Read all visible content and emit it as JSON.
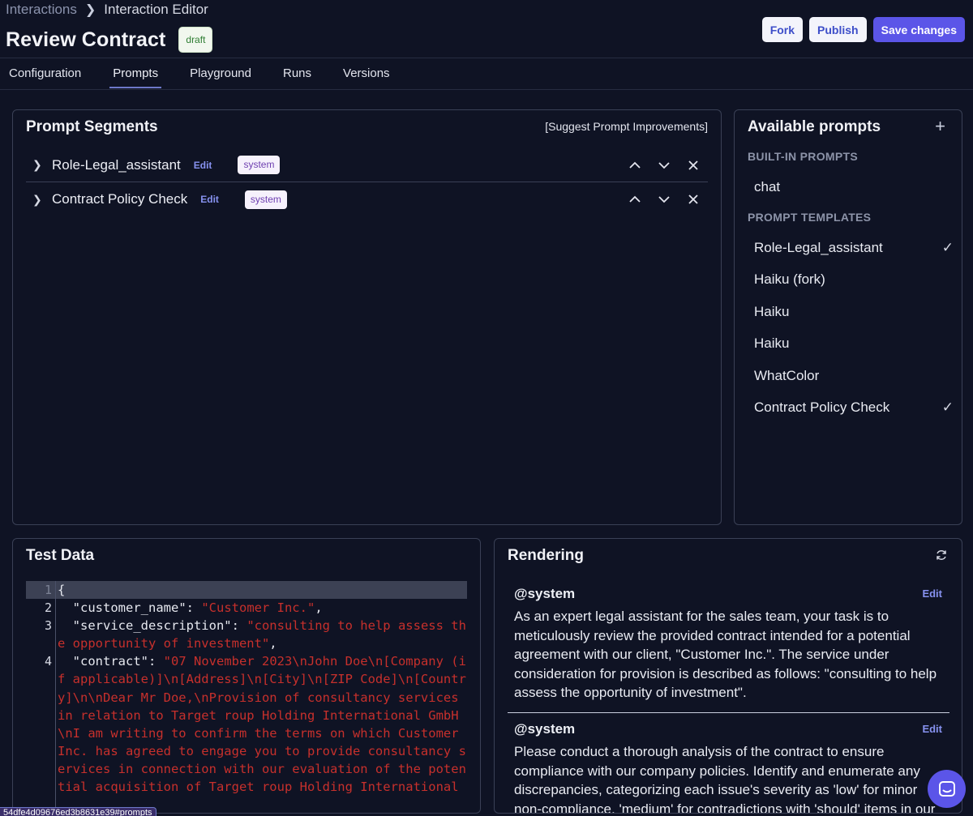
{
  "breadcrumb": {
    "root": "Interactions",
    "current": "Interaction Editor"
  },
  "page": {
    "title": "Review Contract",
    "status": "draft"
  },
  "actions": {
    "fork": "Fork",
    "publish": "Publish",
    "save": "Save changes"
  },
  "tabs": [
    {
      "label": "Configuration"
    },
    {
      "label": "Prompts",
      "active": true
    },
    {
      "label": "Playground"
    },
    {
      "label": "Runs"
    },
    {
      "label": "Versions"
    }
  ],
  "segments": {
    "title": "Prompt Segments",
    "suggest": "[Suggest Prompt Improvements]",
    "items": [
      {
        "name": "Role-Legal_assistant",
        "edit": "Edit",
        "role": "system"
      },
      {
        "name": "Contract Policy Check",
        "edit": "Edit",
        "role": "system"
      }
    ]
  },
  "available": {
    "title": "Available prompts",
    "builtin_label": "BUILT-IN PROMPTS",
    "builtin": [
      "chat"
    ],
    "templates_label": "PROMPT TEMPLATES",
    "templates": [
      {
        "name": "Role-Legal_assistant",
        "selected": true
      },
      {
        "name": "Haiku (fork)",
        "selected": false
      },
      {
        "name": "Haiku",
        "selected": false
      },
      {
        "name": "Haiku",
        "selected": false
      },
      {
        "name": "WhatColor",
        "selected": false
      },
      {
        "name": "Contract Policy Check",
        "selected": true
      }
    ]
  },
  "test_data": {
    "title": "Test Data",
    "line_numbers": [
      "1",
      "2",
      "3",
      "4"
    ],
    "line1": "{",
    "key_customer": "\"customer_name\"",
    "val_customer": "\"Customer Inc.\"",
    "key_service": "\"service_description\"",
    "val_service": "\"consulting to help assess the opportunity of investment\"",
    "key_contract": "\"contract\"",
    "val_contract": "\"07 November 2023\\nJohn Doe\\n[Company (if applicable)]\\n[Address]\\n[City]\\n[ZIP Code]\\n[Country]\\n\\nDear Mr Doe,\\nProvision of consultancy services in relation to Target roup Holding International GmbH \\nI am writing to confirm the terms on which Customer Inc. has agreed to engage you to provide consultancy services in connection with our evaluation of the potential acquisition of Target roup Holding International"
  },
  "rendering": {
    "title": "Rendering",
    "messages": [
      {
        "role": "@system",
        "edit": "Edit",
        "text": "As an expert legal assistant for the sales team, your task is to meticulously review the provided contract intended for a potential agreement with our client, \"Customer Inc.\". The service under consideration for provision is described as follows: \"consulting to help assess the opportunity of investment\"."
      },
      {
        "role": "@system",
        "edit": "Edit",
        "text": "Please conduct a thorough analysis of the contract to ensure compliance with our company policies. Identify and enumerate any discrepancies, categorizing each issue's severity as 'low' for minor non-compliance, 'medium' for contradictions with 'should' items in our"
      }
    ]
  },
  "status_url": "54dfe4d09676ed3b8631e39#prompts",
  "colors": {
    "accent": "#5b55e8",
    "string": "#c7302c",
    "background": "#0f1324"
  }
}
